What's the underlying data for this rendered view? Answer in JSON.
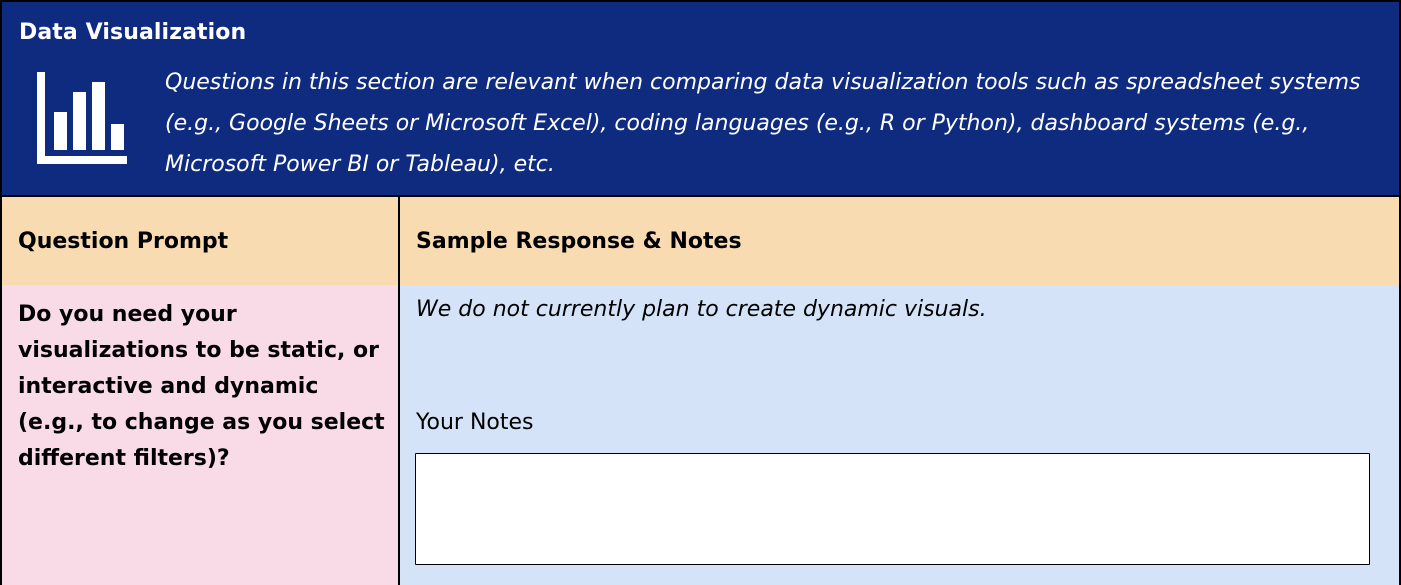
{
  "section": {
    "title": "Data Visualization",
    "icon": "bar-chart-icon",
    "description": "Questions in this section are relevant when comparing data visualization tools such as spreadsheet systems (e.g., Google Sheets or Microsoft Excel), coding languages (e.g., R or Python), dashboard systems (e.g., Microsoft Power BI or Tableau), etc."
  },
  "table": {
    "headers": [
      "Question Prompt",
      "Sample Response & Notes"
    ],
    "rows": [
      {
        "prompt": "Do you need your visualizations to be static, or interactive and dynamic (e.g., to change as you select different filters)?",
        "sample_response": "We do not currently plan to create dynamic visuals.",
        "notes_label": "Your Notes",
        "notes_value": ""
      }
    ]
  },
  "colors": {
    "header_band": "#0f2b7f",
    "table_header": "#f8dbb0",
    "prompt_cell": "#f8dbe6",
    "response_cell": "#d5e3f8"
  }
}
